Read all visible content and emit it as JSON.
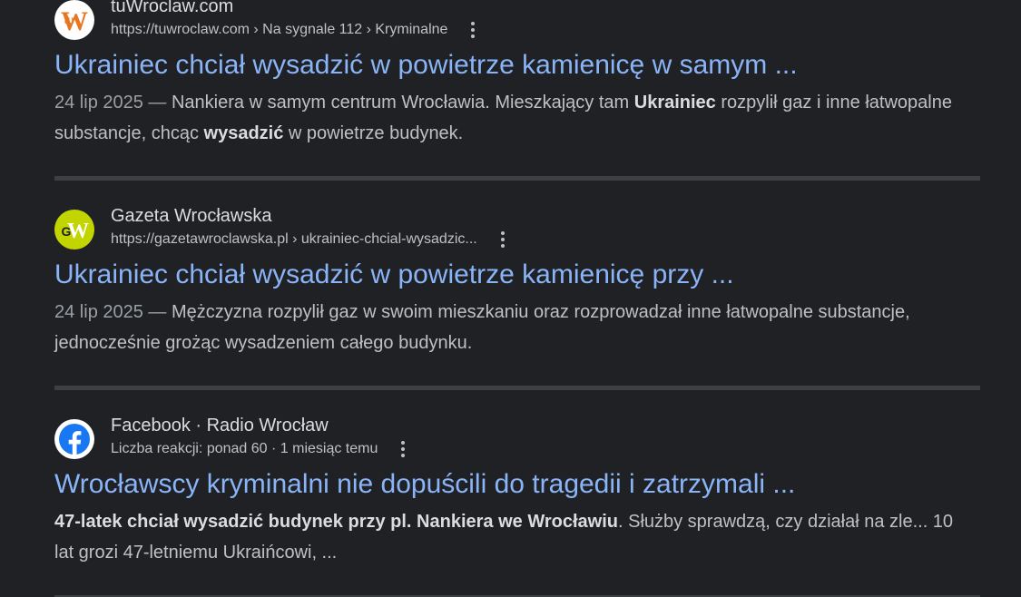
{
  "colors": {
    "background": "#202124",
    "title_link": "#8ab4f8",
    "text": "#bdc1c6",
    "divider": "#3c4043",
    "tuwroclaw_brand": "#e8761e",
    "gazeta_brand": "#c2d500",
    "facebook_brand": "#1877f2"
  },
  "results": [
    {
      "site_name": "tuWroclaw.com",
      "url": "https://tuwroclaw.com › Na sygnale 112 › Kryminalne",
      "favicon": "tuwroclaw-logo-icon",
      "title": "Ukrainiec chciał wysadzić w powietrze kamienicę w samym ...",
      "date": "24 lip 2025 — ",
      "snippet_parts": [
        "Nankiera w samym centrum Wrocławia. Mieszkający tam ",
        "Ukrainiec",
        " rozpylił gaz i inne łatwopalne substancje, chcąc ",
        "wysadzić",
        " w powietrze budynek."
      ]
    },
    {
      "site_name": "Gazeta Wrocławska",
      "url": "https://gazetawroclawska.pl › ukrainiec-chcial-wysadzic...",
      "favicon": "gazeta-wroclawska-logo-icon",
      "title": "Ukrainiec chciał wysadzić w powietrze kamienicę przy ...",
      "date": "24 lip 2025 — ",
      "snippet_parts": [
        "Mężczyzna rozpylił gaz w swoim mieszkaniu oraz rozprowadzał inne łatwopalne substancje, jednocześnie grożąc wysadzeniem całego budynku."
      ]
    },
    {
      "site_name": "Facebook · Radio Wrocław",
      "url": "Liczba reakcji: ponad 60 · 1 miesiąc temu",
      "favicon": "facebook-logo-icon",
      "title": "Wrocławscy kryminalni nie dopuścili do tragedii i zatrzymali ...",
      "snippet_parts": [
        "47-latek chciał wysadzić budynek przy pl. Nankiera we Wrocławiu",
        ". Służby sprawdzą, czy działał na zle... 10 lat grozi 47-letniemu Ukraińcowi, ..."
      ]
    }
  ]
}
